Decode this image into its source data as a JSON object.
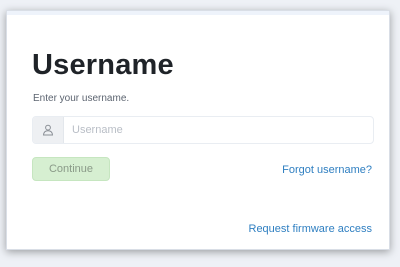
{
  "login": {
    "title": "Username",
    "subtitle": "Enter your username.",
    "username_placeholder": "Username",
    "username_value": "",
    "user_icon": "user-icon",
    "continue_label": "Continue",
    "forgot_link": "Forgot username?",
    "firmware_link": "Request firmware access"
  },
  "colors": {
    "continue_bg": "#d6efd1",
    "link": "#2f7fc1",
    "title": "#1f2328"
  }
}
